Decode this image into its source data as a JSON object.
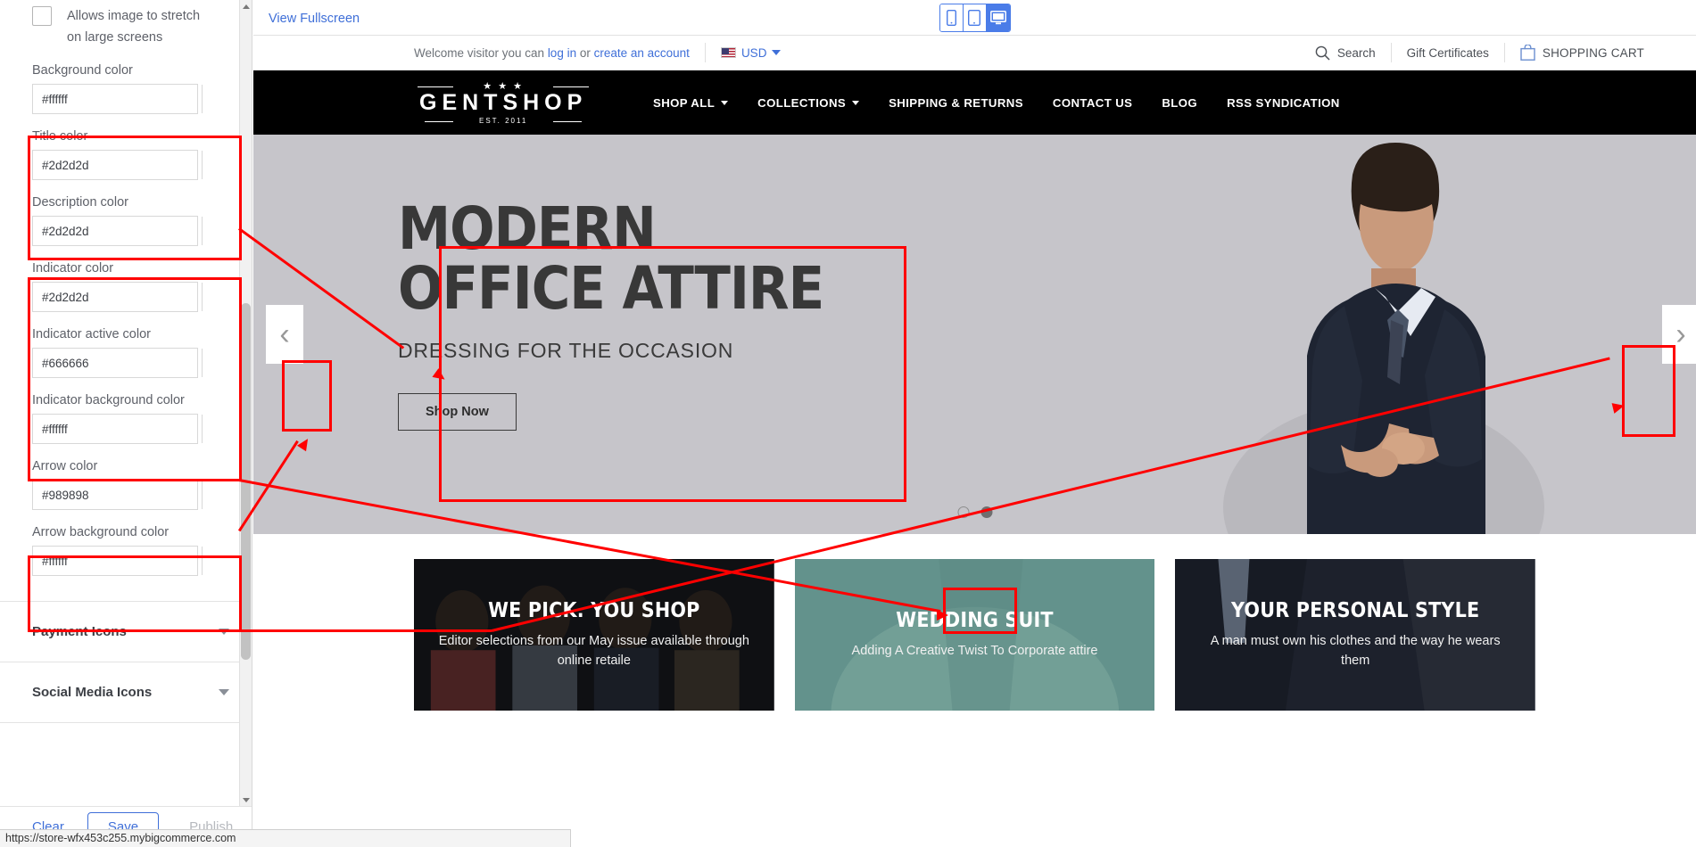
{
  "sidebar": {
    "stretch_checkbox_label": "Allows image to stretch on large screens",
    "fields": [
      {
        "label": "Background color",
        "value": "#ffffff",
        "swatch": "#ffffff"
      },
      {
        "label": "Title color",
        "value": "#2d2d2d",
        "swatch": "#2d2d2d"
      },
      {
        "label": "Description color",
        "value": "#2d2d2d",
        "swatch": "#2d2d2d"
      },
      {
        "label": "Indicator color",
        "value": "#2d2d2d",
        "swatch": "#2d2d2d"
      },
      {
        "label": "Indicator active color",
        "value": "#666666",
        "swatch": "#666666"
      },
      {
        "label": "Indicator background color",
        "value": "#ffffff",
        "swatch": "#ffffff"
      },
      {
        "label": "Arrow color",
        "value": "#989898",
        "swatch": "#989898"
      },
      {
        "label": "Arrow background color",
        "value": "#ffffff",
        "swatch": "#ffffff"
      }
    ],
    "accordions": [
      {
        "title": "Payment Icons"
      },
      {
        "title": "Social Media Icons"
      }
    ],
    "footer": {
      "clear_label": "Clear",
      "save_label": "Save",
      "publish_label": "Publish"
    }
  },
  "statusbar": {
    "url": "https://store-wfx453c255.mybigcommerce.com"
  },
  "preview_toolbar": {
    "fullscreen_label": "View Fullscreen",
    "devices": [
      {
        "name": "mobile-view",
        "active": false
      },
      {
        "name": "tablet-view",
        "active": false
      },
      {
        "name": "desktop-view",
        "active": true
      }
    ]
  },
  "store": {
    "utility": {
      "welcome_prefix": "Welcome visitor you can ",
      "login_label": "log in",
      "or_label": " or ",
      "create_account_label": "create an account",
      "currency_label": "USD",
      "search_label": "Search",
      "gift_certificates_label": "Gift Certificates",
      "cart_label": "SHOPPING CART"
    },
    "logo": {
      "stars": "★ ★ ★",
      "name": "GENTSHOP",
      "est": "EST. 2011"
    },
    "nav": [
      {
        "label": "SHOP ALL",
        "has_dropdown": true
      },
      {
        "label": "COLLECTIONS",
        "has_dropdown": true
      },
      {
        "label": "SHIPPING & RETURNS",
        "has_dropdown": false
      },
      {
        "label": "CONTACT US",
        "has_dropdown": false
      },
      {
        "label": "BLOG",
        "has_dropdown": false
      },
      {
        "label": "RSS SYNDICATION",
        "has_dropdown": false
      }
    ],
    "hero": {
      "title_line1": "MODERN",
      "title_line2": "OFFICE ATTIRE",
      "subtitle": "DRESSING FOR THE OCCASION",
      "button_label": "Shop Now",
      "prev_arrow": "‹",
      "next_arrow": "›",
      "slide_count": 2,
      "active_slide": 2,
      "background_color": "#c6c5ca",
      "title_color": "#2d2d2d",
      "arrow_color": "#989898",
      "arrow_background_color": "#ffffff",
      "indicator_color": "#2d2d2d",
      "indicator_active_color": "#666666",
      "indicator_background_color": "#ffffff"
    },
    "promos": [
      {
        "title": "WE PICK. YOU SHOP",
        "description": "Editor selections from our May issue available through online retaile"
      },
      {
        "title": "WEDDING SUIT",
        "description": "Adding A Creative Twist To Corporate attire"
      },
      {
        "title": "YOUR PERSONAL STYLE",
        "description": "A man must own his clothes and the way he wears them"
      }
    ]
  }
}
